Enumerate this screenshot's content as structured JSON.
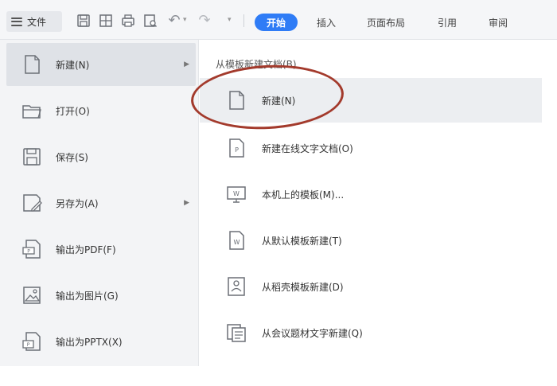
{
  "toolbar": {
    "file_label": "文件",
    "quick_icons": [
      "save-icon",
      "export-icon",
      "print-icon",
      "preview-icon",
      "undo-icon",
      "redo-icon",
      "more-icon"
    ],
    "tabs": [
      {
        "label": "开始",
        "active": true
      },
      {
        "label": "插入",
        "active": false
      },
      {
        "label": "页面布局",
        "active": false
      },
      {
        "label": "引用",
        "active": false
      },
      {
        "label": "审阅",
        "active": false
      }
    ]
  },
  "file_menu": {
    "items": [
      {
        "label": "新建(N)",
        "icon": "new-file-icon",
        "has_submenu": true,
        "selected": true
      },
      {
        "label": "打开(O)",
        "icon": "folder-open-icon",
        "has_submenu": false
      },
      {
        "label": "保存(S)",
        "icon": "save-icon",
        "has_submenu": false
      },
      {
        "label": "另存为(A)",
        "icon": "save-as-icon",
        "has_submenu": true
      },
      {
        "label": "输出为PDF(F)",
        "icon": "export-pdf-icon",
        "has_submenu": false
      },
      {
        "label": "输出为图片(G)",
        "icon": "export-image-icon",
        "has_submenu": false
      },
      {
        "label": "输出为PPTX(X)",
        "icon": "export-pptx-icon",
        "has_submenu": false
      }
    ]
  },
  "new_submenu": {
    "header": "从模板新建文档(B)",
    "items": [
      {
        "label": "新建(N)",
        "icon": "blank-doc-icon",
        "highlight": true
      },
      {
        "label": "新建在线文字文档(O)",
        "icon": "online-doc-icon"
      },
      {
        "label": "本机上的模板(M)...",
        "icon": "local-template-icon"
      },
      {
        "label": "从默认模板新建(T)",
        "icon": "default-template-icon"
      },
      {
        "label": "从稻壳模板新建(D)",
        "icon": "docer-template-icon"
      },
      {
        "label": "从会议题材文字新建(Q)",
        "icon": "meeting-doc-icon"
      }
    ]
  },
  "colors": {
    "accent": "#2f7cf6",
    "annotation": "#a33a2c"
  }
}
